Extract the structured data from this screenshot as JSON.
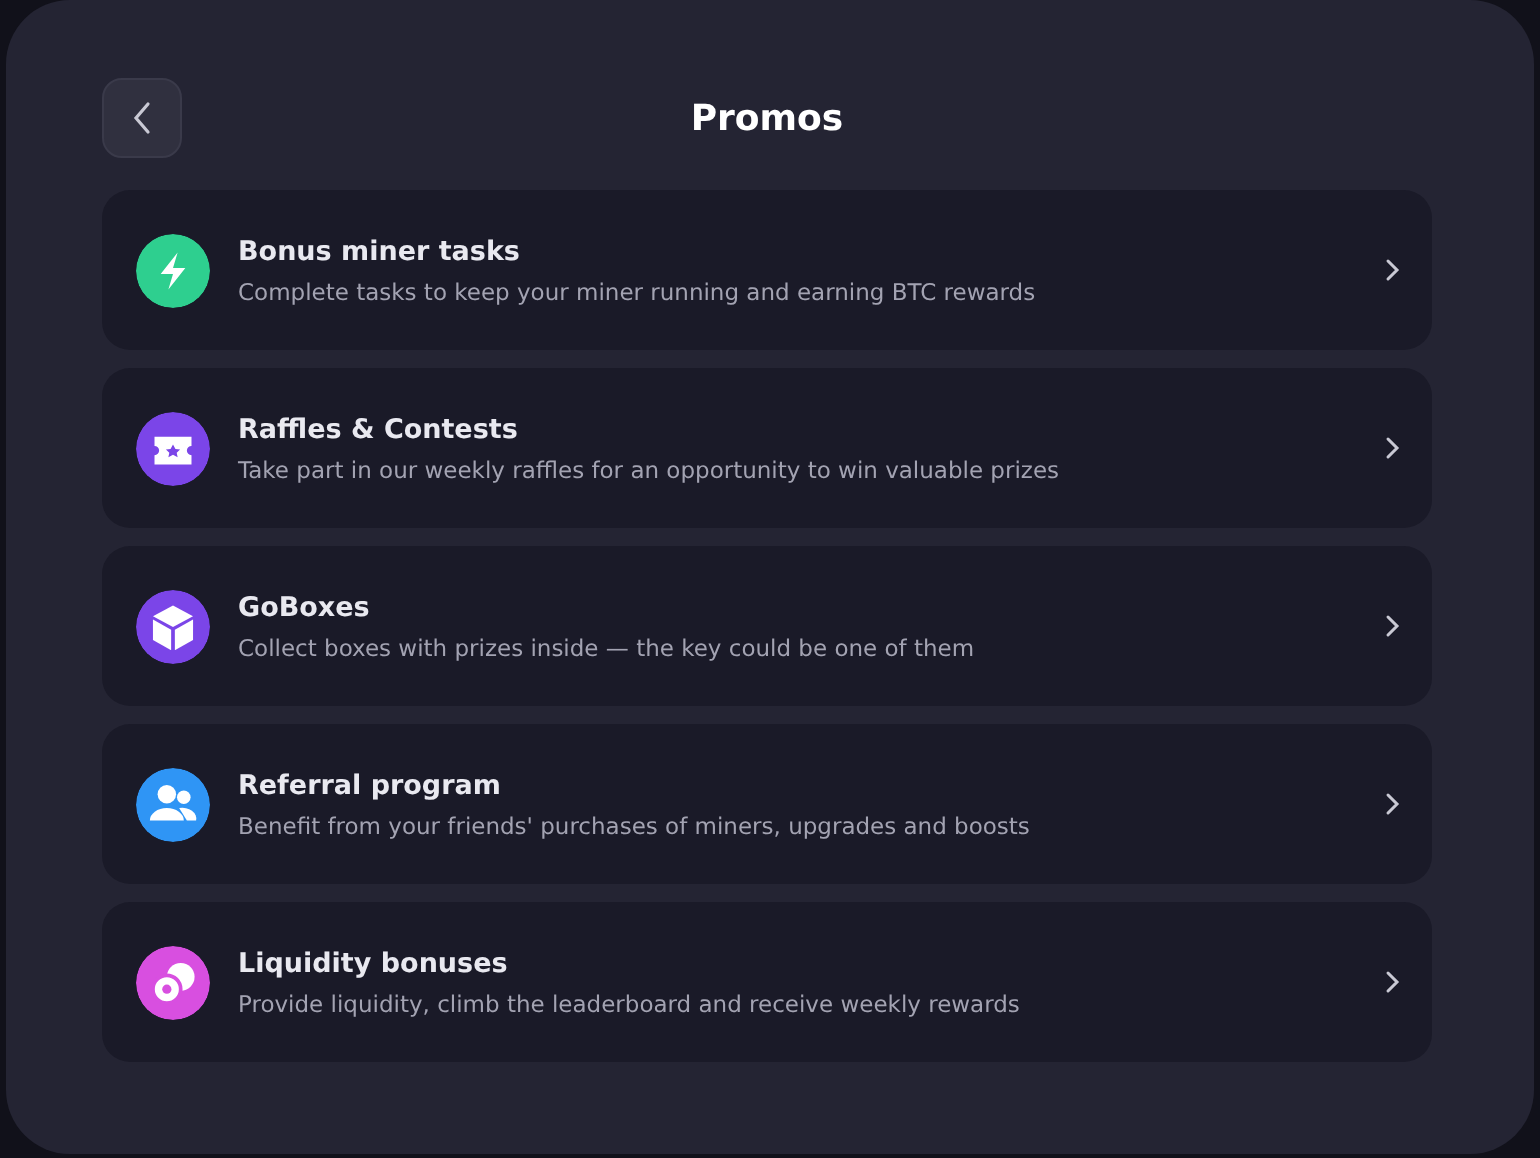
{
  "header": {
    "title": "Promos"
  },
  "promos": [
    {
      "kind": "bolt",
      "color": "#2ecf8f",
      "title": "Bonus miner tasks",
      "description": "Complete tasks to keep your miner running and earning BTC rewards"
    },
    {
      "kind": "ticket",
      "color": "#7b45e8",
      "title": "Raffles & Contests",
      "description": "Take part in our weekly raffles for an opportunity to win valuable prizes"
    },
    {
      "kind": "box",
      "color": "#7b45e8",
      "title": "GoBoxes",
      "description": "Collect boxes with prizes inside — the key could be one of them"
    },
    {
      "kind": "people",
      "color": "#2f95f5",
      "title": "Referral program",
      "description": "Benefit from your friends' purchases of miners, upgrades and boosts"
    },
    {
      "kind": "coins",
      "color": "#d84fe0",
      "title": "Liquidity bonuses",
      "description": "Provide liquidity, climb the leaderboard and receive weekly rewards"
    }
  ]
}
